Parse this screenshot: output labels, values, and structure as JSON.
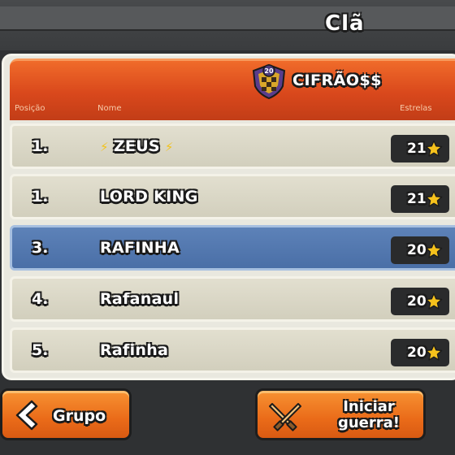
{
  "header": {
    "title": "Clã"
  },
  "clan": {
    "level": "20",
    "name": "CIFRÃO$$",
    "columns": {
      "position": "Posição",
      "name": "Nome",
      "stars": "Estrelas"
    }
  },
  "members": [
    {
      "position": "1.",
      "name": "ZEUS",
      "stars": "21",
      "decorated": true,
      "self": false
    },
    {
      "position": "1.",
      "name": "LORD KING",
      "stars": "21",
      "decorated": false,
      "self": false
    },
    {
      "position": "3.",
      "name": "RAFINHA",
      "stars": "20",
      "decorated": false,
      "self": true
    },
    {
      "position": "4.",
      "name": "Rafanaul",
      "stars": "20",
      "decorated": false,
      "self": false
    },
    {
      "position": "5.",
      "name": "Rafinha",
      "stars": "20",
      "decorated": false,
      "self": false
    }
  ],
  "decoration": {
    "left": "⚡",
    "right": "⚡"
  },
  "buttons": {
    "group": "Grupo",
    "war_line1": "Iniciar",
    "war_line2": "guerra!"
  },
  "colors": {
    "header_orange": "#d9481c",
    "self_row_blue": "#4a6fa7",
    "button_orange": "#ea6b19",
    "star_gold": "#f6c21c"
  },
  "icons": {
    "badge": "clan-badge-icon",
    "star": "star-icon",
    "back": "chevron-left-icon",
    "war": "crossed-swords-icon",
    "decoration": "lightning-icon"
  }
}
